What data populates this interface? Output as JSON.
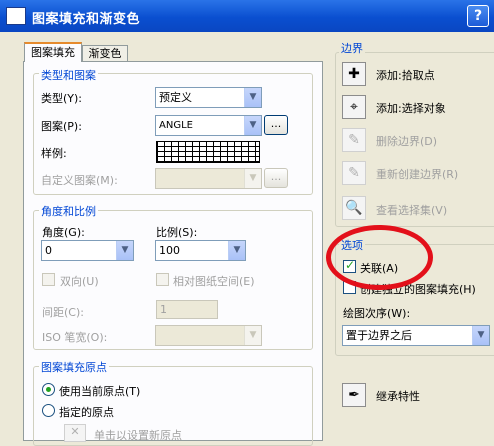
{
  "window": {
    "title": "图案填充和渐变色",
    "help": "?"
  },
  "tabs": [
    {
      "label": "图案填充"
    },
    {
      "label": "渐变色"
    }
  ],
  "type_pattern": {
    "legend": "类型和图案",
    "type_label": "类型(Y):",
    "type_value": "预定义",
    "pattern_label": "图案(P):",
    "pattern_value": "ANGLE",
    "browse_label": "...",
    "sample_label": "样例:",
    "custom_label": "自定义图案(M):",
    "custom_browse": "..."
  },
  "angle_scale": {
    "legend": "角度和比例",
    "angle_label": "角度(G):",
    "angle_value": "0",
    "scale_label": "比例(S):",
    "scale_value": "100",
    "double_label": "双向(U)",
    "paper_space_label": "相对图纸空间(E)",
    "spacing_label": "间距(C):",
    "spacing_value": "1",
    "iso_label": "ISO 笔宽(O):"
  },
  "origin": {
    "legend": "图案填充原点",
    "use_current": "使用当前原点(T)",
    "specified": "指定的原点",
    "click_set": "单击以设置新原点"
  },
  "boundary": {
    "legend": "边界",
    "items": [
      {
        "label": "添加:拾取点",
        "icon": "pick-point-icon"
      },
      {
        "label": "添加:选择对象",
        "icon": "select-objects-icon"
      },
      {
        "label": "删除边界(D)",
        "icon": "remove-boundary-icon"
      },
      {
        "label": "重新创建边界(R)",
        "icon": "recreate-boundary-icon"
      },
      {
        "label": "查看选择集(V)",
        "icon": "view-selection-icon"
      }
    ]
  },
  "options": {
    "legend": "选项",
    "associative_label": "关联(A)",
    "separate_label": "创建独立的图案填充(H)",
    "draw_order_label": "绘图次序(W):",
    "draw_order_value": "置于边界之后"
  },
  "inherit": {
    "label": "继承特性",
    "icon": "inherit-properties-icon"
  }
}
